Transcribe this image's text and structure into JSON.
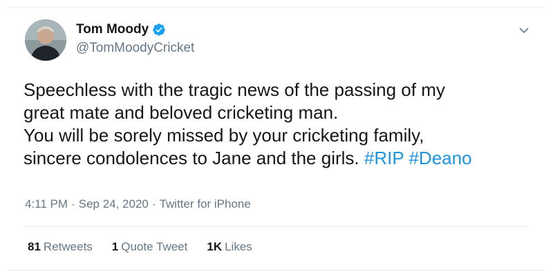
{
  "author": {
    "display_name": "Tom Moody",
    "handle": "@TomMoodyCricket",
    "verified": true
  },
  "tweet": {
    "line1": "Speechless with the tragic news of the passing of my",
    "line2": "great mate and beloved cricketing man.",
    "line3": "You will be sorely missed by your cricketing family,",
    "line4": "sincere condolences to Jane and the girls.",
    "hashtags": [
      "#RIP",
      "#Deano"
    ]
  },
  "meta": {
    "time": "4:11 PM",
    "separator": "·",
    "date": "Sep 24, 2020",
    "source": "Twitter for iPhone"
  },
  "stats": {
    "retweets_count": "81",
    "retweets_label": "Retweets",
    "quotes_count": "1",
    "quotes_label": "Quote Tweet",
    "likes_count": "1K",
    "likes_label": "Likes"
  },
  "colors": {
    "link": "#1b95e0",
    "verified": "#1da1f2",
    "secondary_text": "#657786"
  },
  "icons": [
    "verified-badge-icon",
    "chevron-down-icon"
  ]
}
